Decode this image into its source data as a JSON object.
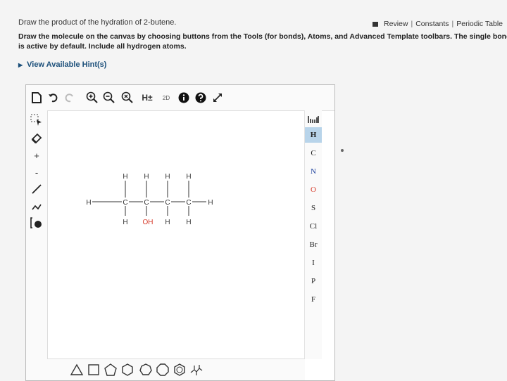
{
  "header": {
    "prompt": "Draw the product of the hydration of 2-butene.",
    "links": [
      "Review",
      "Constants",
      "Periodic Table"
    ],
    "instructions": "Draw the molecule on the canvas by choosing buttons from the Tools (for bonds), Atoms, and Advanced Template toolbars. The single bond is active by default. Include all hydrogen atoms.",
    "hints_label": "View Available Hint(s)"
  },
  "toolbar": {
    "h_label": "H±",
    "twod_label": "2D"
  },
  "atoms": [
    {
      "symbol": "H",
      "active": true,
      "color": "#222222"
    },
    {
      "symbol": "C",
      "active": false,
      "color": "#222222"
    },
    {
      "symbol": "N",
      "active": false,
      "color": "#1b3f9c"
    },
    {
      "symbol": "O",
      "active": false,
      "color": "#d63a2a"
    },
    {
      "symbol": "S",
      "active": false,
      "color": "#222222"
    },
    {
      "symbol": "Cl",
      "active": false,
      "color": "#222222"
    },
    {
      "symbol": "Br",
      "active": false,
      "color": "#222222"
    },
    {
      "symbol": "I",
      "active": false,
      "color": "#222222"
    },
    {
      "symbol": "P",
      "active": false,
      "color": "#222222"
    },
    {
      "symbol": "F",
      "active": false,
      "color": "#222222"
    }
  ],
  "molecule": {
    "left_h": "H",
    "right_h": "H",
    "carbons": [
      "C",
      "C",
      "C",
      "C"
    ],
    "top_h": [
      "H",
      "H",
      "H",
      "H"
    ],
    "bottom": [
      "H",
      "OH",
      "H",
      "H"
    ]
  },
  "colors": {
    "accent": "#b8d4ea",
    "link": "#1b4f7a",
    "oxygen": "#d63a2a"
  }
}
